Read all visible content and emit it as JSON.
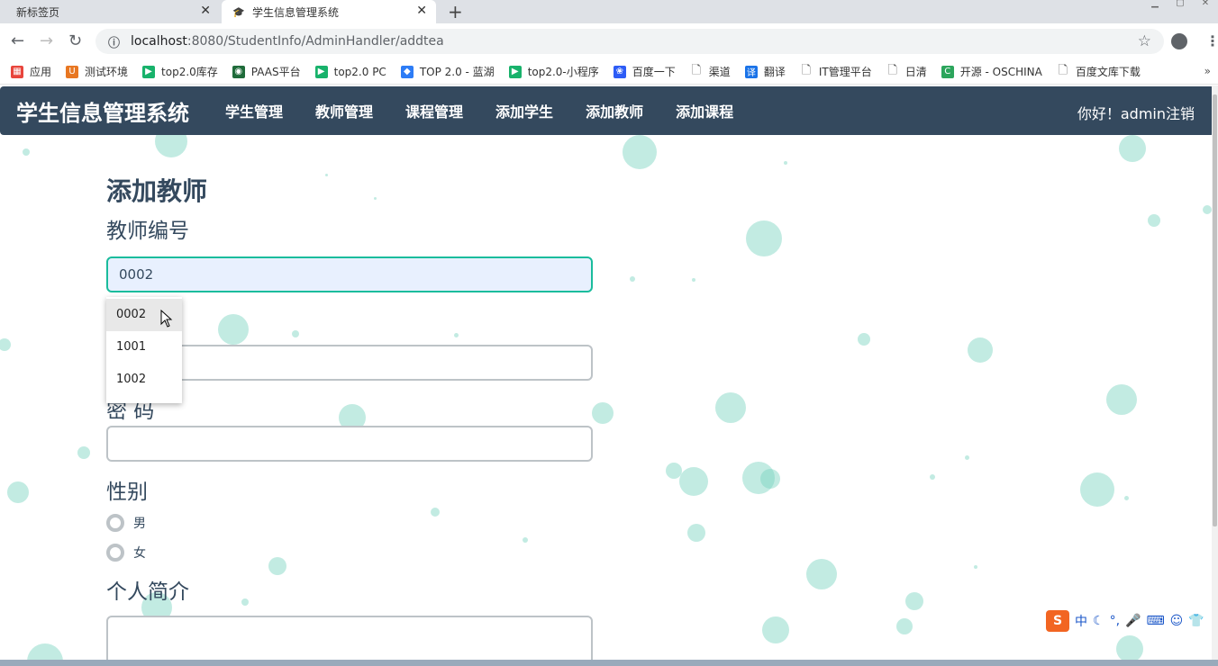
{
  "browser": {
    "tabs": [
      {
        "label": "新标签页"
      },
      {
        "label": "学生信息管理系统"
      }
    ],
    "url_host": "localhost",
    "url_path": ":8080/StudentInfo/AdminHandler/addtea",
    "bookmarks": [
      {
        "label": "应用",
        "icon": "apps-grid-icon"
      },
      {
        "label": "测试环境",
        "icon": "bookmark-u-icon"
      },
      {
        "label": "top2.0库存",
        "icon": "bookmark-play-icon"
      },
      {
        "label": "PAAS平台",
        "icon": "bookmark-paas-icon"
      },
      {
        "label": "top2.0 PC",
        "icon": "bookmark-play-icon"
      },
      {
        "label": "TOP 2.0 - 蓝湖",
        "icon": "bookmark-lanhu-icon"
      },
      {
        "label": "top2.0-小程序",
        "icon": "bookmark-play-icon"
      },
      {
        "label": "百度一下",
        "icon": "baidu-icon"
      },
      {
        "label": "渠道",
        "icon": "page-icon"
      },
      {
        "label": "翻译",
        "icon": "translate-icon"
      },
      {
        "label": "IT管理平台",
        "icon": "page-icon"
      },
      {
        "label": "日清",
        "icon": "page-icon"
      },
      {
        "label": "开源 - OSCHINA",
        "icon": "oschina-icon"
      },
      {
        "label": "百度文库下载",
        "icon": "page-icon"
      }
    ],
    "bookmarks_more": "»"
  },
  "site": {
    "brand": "学生信息管理系统",
    "nav": [
      "学生管理",
      "教师管理",
      "课程管理",
      "添加学生",
      "添加教师",
      "添加课程"
    ],
    "user_text": "你好！admin注销"
  },
  "form": {
    "title": "添加教师",
    "teacher_id_label": "教师编号",
    "teacher_id_value": "0002",
    "password_label_partial": "密 码",
    "gender_label": "性别",
    "gender_options": [
      "男",
      "女"
    ],
    "intro_label": "个人简介"
  },
  "autocomplete": [
    "0002",
    "1001",
    "1002"
  ],
  "ime": {
    "logo": "S",
    "mode": "中"
  },
  "colors": {
    "navbar": "#34495e",
    "accent": "#1abc9c",
    "bubble": "#7fd3c0"
  }
}
